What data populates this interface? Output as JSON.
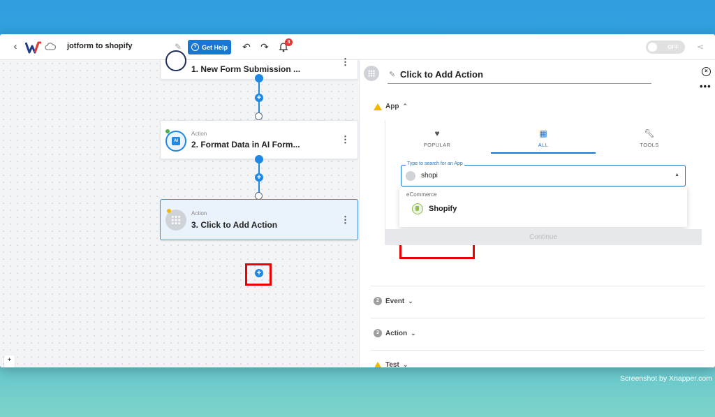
{
  "topbar": {
    "title": "jotform to shopify",
    "help_label": "Get Help",
    "notification_count": "3",
    "toggle_label": "OFF"
  },
  "workflow": {
    "nodes": [
      {
        "type": "",
        "title": "1. New Form Submission ..."
      },
      {
        "type": "Action",
        "title": "2. Format Data in AI Form..."
      },
      {
        "type": "Action",
        "title": "3. Click to Add Action"
      }
    ],
    "ai_badge": "AI"
  },
  "panel": {
    "title": "Click to Add Action",
    "sections": {
      "app": "App",
      "event": "Event",
      "action": "Action",
      "test": "Test"
    },
    "step_numbers": {
      "event": "2",
      "action": "3"
    },
    "tabs": [
      {
        "label": "POPULAR",
        "icon": "heart-icon"
      },
      {
        "label": "ALL",
        "icon": "grid-icon"
      },
      {
        "label": "TOOLS",
        "icon": "wrench-icon"
      }
    ],
    "search": {
      "label": "Type to search for an App",
      "value": "shopi"
    },
    "dropdown": {
      "group": "eCommerce",
      "option": "Shopify"
    },
    "continue_label": "Continue"
  },
  "zoom_controls": [
    "+",
    "−",
    "⛶",
    "🔒"
  ],
  "watermark": "Screenshot by Xnapper.com",
  "colors": {
    "accent": "#1976d2",
    "highlight": "#e00000",
    "warning": "#f5b400"
  }
}
